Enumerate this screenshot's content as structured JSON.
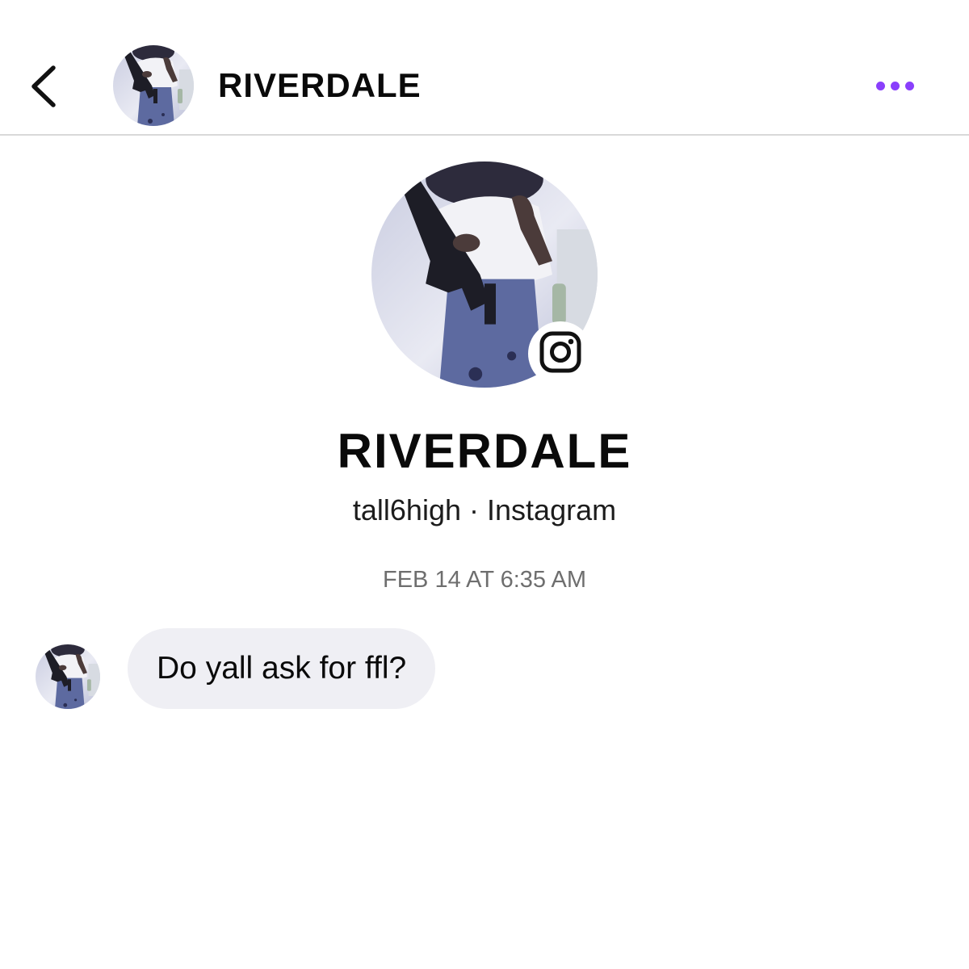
{
  "header": {
    "title": "RIVERDALE",
    "back_icon": "chevron-left-icon",
    "more_icon": "more-horizontal-icon",
    "accent_color": "#8a3ffc"
  },
  "profile": {
    "name": "RIVERDALE",
    "username": "tall6high",
    "separator": "·",
    "platform": "Instagram",
    "badge_icon": "instagram-icon"
  },
  "conversation": {
    "timestamp": "FEB 14 AT 6:35 AM",
    "messages": [
      {
        "sender": "RIVERDALE",
        "text": "Do yall ask for ffl?"
      }
    ],
    "bubble_color": "#efeff4"
  }
}
